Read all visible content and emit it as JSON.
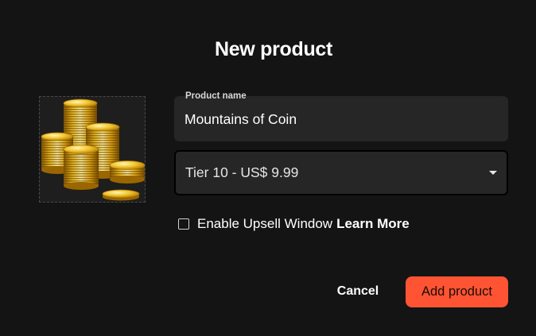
{
  "dialog": {
    "title": "New product"
  },
  "product_image": {
    "icon": "gold-coins-stack-icon"
  },
  "name_field": {
    "label": "Product name",
    "value": "Mountains of Coin"
  },
  "tier_select": {
    "selected": "Tier 10 - US$ 9.99",
    "icon": "caret-down-icon"
  },
  "upsell": {
    "checked": false,
    "label": "Enable Upsell Window",
    "link": "Learn More"
  },
  "actions": {
    "cancel_label": "Cancel",
    "submit_label": "Add product"
  },
  "colors": {
    "background": "#141414",
    "field": "#262626",
    "accent": "#ff5433",
    "gold": "#e8b417"
  }
}
